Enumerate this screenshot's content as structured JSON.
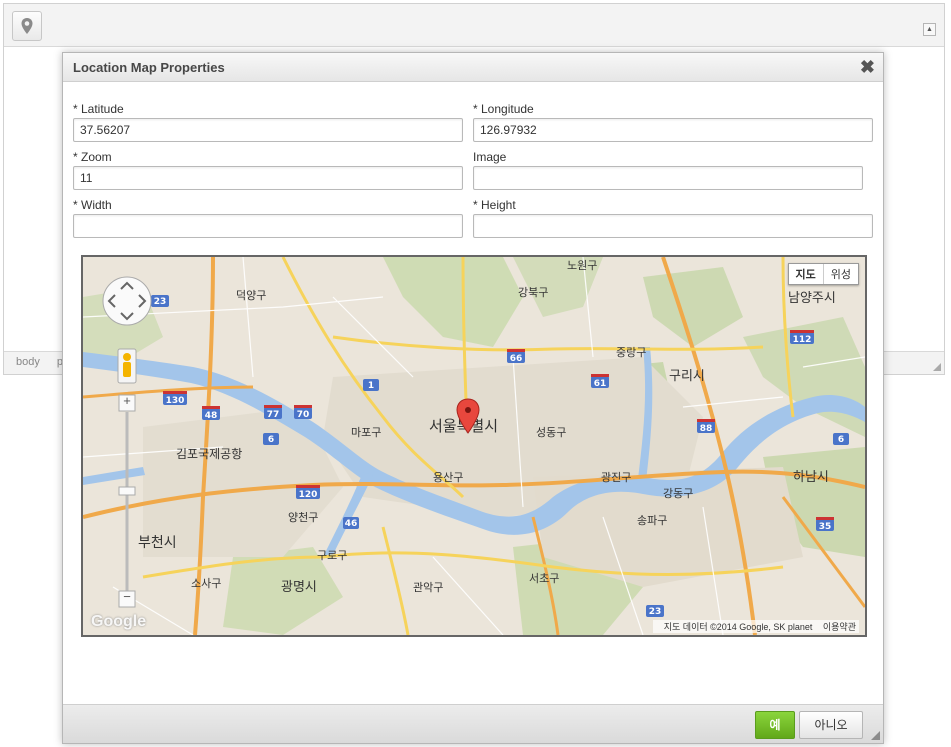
{
  "editor": {
    "status_path": [
      "body",
      "p"
    ]
  },
  "dialog": {
    "title": "Location Map Properties",
    "close_symbol": "✖",
    "fields": {
      "latitude": {
        "label": "* Latitude",
        "value": "37.56207"
      },
      "longitude": {
        "label": "* Longitude",
        "value": "126.97932"
      },
      "zoom": {
        "label": "* Zoom",
        "value": "11"
      },
      "image": {
        "label": "Image",
        "value": ""
      },
      "width": {
        "label": "* Width",
        "value": ""
      },
      "height": {
        "label": "* Height",
        "value": ""
      }
    },
    "map": {
      "type_map": "지도",
      "type_satellite": "위성",
      "attribution": "지도 데이터 ©2014 Google, SK planet",
      "terms": "이용약관",
      "logo": "Google",
      "zoom_in": "+",
      "zoom_out": "−",
      "labels": {
        "center": "서울특별시",
        "gimpo": "김포국제공항",
        "bucheon": "부천시",
        "gwangmyeong": "광명시",
        "guri": "구리시",
        "hanam": "하남시",
        "namyangju": "남양주시",
        "mapo": "마포구",
        "yongsan": "용산구",
        "seongdong": "성동구",
        "gangbuk": "강북구",
        "nowon": "노원구",
        "jungnang": "중랑구",
        "gwangjin": "광진구",
        "gangdong": "강동구",
        "songpa": "송파구",
        "seocho": "서초구",
        "gwanak": "관악구",
        "guro": "구로구",
        "yangcheon": "양천구",
        "deokyang": "덕양구",
        "sosa": "소사구"
      },
      "highway_shields": [
        "23",
        "130",
        "48",
        "77",
        "70",
        "1",
        "6",
        "66",
        "61",
        "88",
        "112",
        "120",
        "46",
        "6",
        "35",
        "23"
      ]
    },
    "ok_label": "예",
    "cancel_label": "아니오"
  }
}
